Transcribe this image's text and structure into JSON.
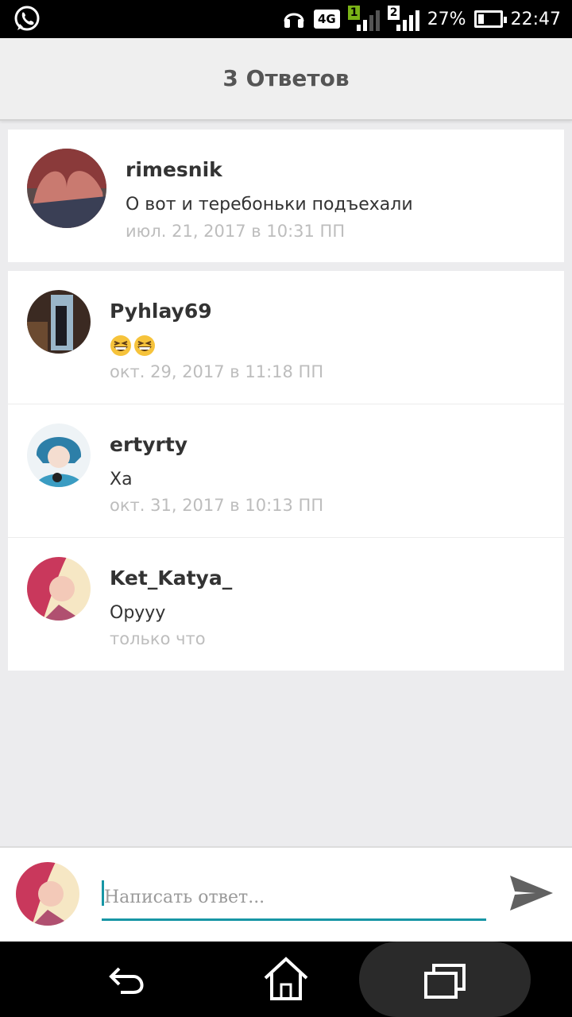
{
  "status_bar": {
    "battery": "27%",
    "battery_level": 0.27,
    "time": "22:47",
    "network": "4G",
    "sim1": "1",
    "sim2": "2",
    "left_icon": "whatsapp-icon",
    "headphones_icon": "headphones-icon"
  },
  "header": {
    "title": "3 Ответов"
  },
  "parent_comment": {
    "author": "rimesnik",
    "text": "О вот и теребоньки подъехали",
    "time": "июл. 21, 2017 в 10:31 ПП"
  },
  "replies": [
    {
      "author": "Pyhlay69",
      "text": "",
      "emoji": [
        "grinning-squinting-face",
        "grinning-squinting-face"
      ],
      "time": "окт. 29, 2017 в 11:18 ПП"
    },
    {
      "author": "ertyrty",
      "text": "Ха",
      "time": "окт. 31, 2017 в 10:13 ПП"
    },
    {
      "author": "Ket_Katya_",
      "text": "Оруyy",
      "time": "только что"
    }
  ],
  "composer": {
    "placeholder": "Написать ответ...",
    "accent": "#1796a5"
  },
  "navbar": {
    "back": "back-icon",
    "home": "home-icon",
    "recents": "recents-icon"
  }
}
